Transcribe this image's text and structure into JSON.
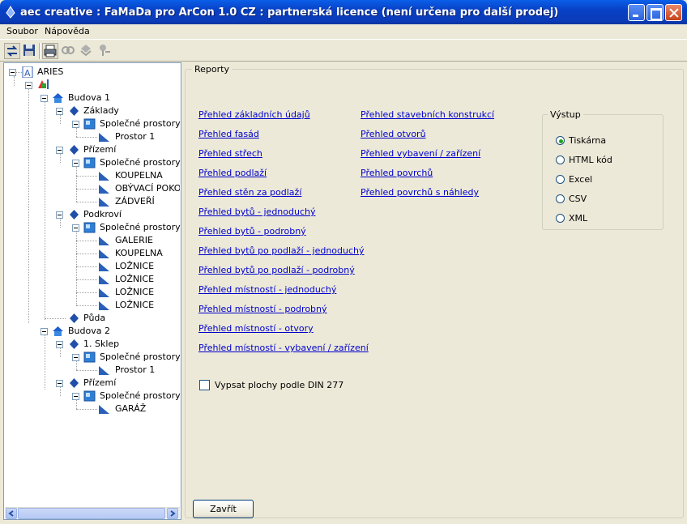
{
  "window": {
    "title": "aec creative : FaMaDa pro ArCon 1.0 CZ : partnerská licence (není určena pro další prodej)"
  },
  "menu": [
    "Soubor",
    "Nápověda"
  ],
  "toolbar": {
    "icons": [
      "refresh-icon",
      "save-icon",
      "print-icon",
      "view-icon",
      "layers-icon",
      "pin-icon"
    ]
  },
  "tree": {
    "root": "ARIES",
    "items": [
      {
        "label": "Budova 1"
      },
      {
        "label": "Základy"
      },
      {
        "label": "Společné prostory"
      },
      {
        "label": "Prostor 1"
      },
      {
        "label": "Přízemí"
      },
      {
        "label": "Společné prostory"
      },
      {
        "label": "KOUPELNA"
      },
      {
        "label": "OBÝVACÍ POKOJ"
      },
      {
        "label": "ZÁDVEŘÍ"
      },
      {
        "label": "Podkroví"
      },
      {
        "label": "Společné prostory"
      },
      {
        "label": "GALERIE"
      },
      {
        "label": "KOUPELNA"
      },
      {
        "label": "LOŽNICE"
      },
      {
        "label": "LOŽNICE"
      },
      {
        "label": "LOŽNICE"
      },
      {
        "label": "LOŽNICE"
      },
      {
        "label": "Půda"
      },
      {
        "label": "Budova 2"
      },
      {
        "label": "1. Sklep"
      },
      {
        "label": "Společné prostory"
      },
      {
        "label": "Prostor 1"
      },
      {
        "label": "Přízemí"
      },
      {
        "label": "Společné prostory"
      },
      {
        "label": "GARÁŽ"
      }
    ]
  },
  "reports": {
    "title": "Reporty",
    "col1": [
      "Přehled základních údajů",
      "Přehled fasád",
      "Přehled střech",
      "Přehled podlaží",
      "Přehled stěn za podlaží",
      "Přehled bytů - jednoduchý",
      "Přehled bytů - podrobný",
      "Přehled bytů po podlaží - jednoduchý",
      "Přehled bytů po podlaží - podrobný",
      "Přehled místností - jednoduchý",
      "Přehled místností - podrobný",
      "Přehled místností - otvory",
      "Přehled místností - vybavení / zařízení"
    ],
    "col2": [
      "Přehled stavebních konstrukcí",
      "Přehled otvorů",
      "Přehled vybavení / zařízení",
      "Přehled povrchů",
      "Přehled povrchů s náhledy"
    ],
    "checkbox": "Vypsat plochy podle DIN 277",
    "close": "Zavřít"
  },
  "output": {
    "title": "Výstup",
    "options": [
      "Tiskárna",
      "HTML kód",
      "Excel",
      "CSV",
      "XML"
    ],
    "selected": "Tiskárna"
  },
  "colors": {
    "title_bar": "#0a4fd6",
    "link": "#0000cc",
    "background": "#ece9d8"
  }
}
